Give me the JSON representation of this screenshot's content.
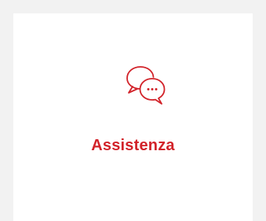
{
  "card": {
    "label": "Assistenza",
    "icon": "chat-bubbles-icon"
  },
  "colors": {
    "accent": "#d2232a",
    "background": "#f2f2f2",
    "card": "#ffffff"
  }
}
